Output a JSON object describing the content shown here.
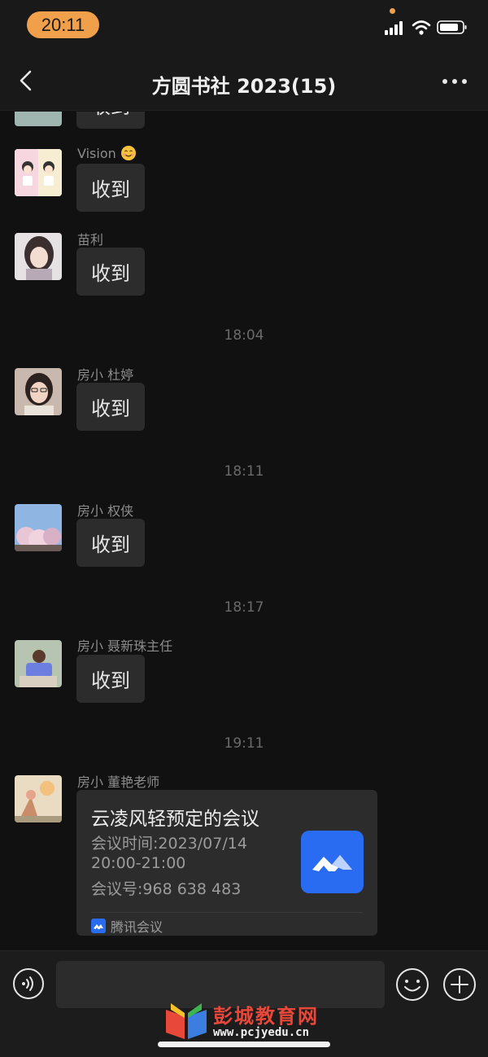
{
  "status_bar": {
    "time": "20:11"
  },
  "nav": {
    "title": "方圆书社 2023(15)"
  },
  "messages": [
    {
      "sender": "",
      "text": "收到"
    },
    {
      "sender": "Vision",
      "text": "收到"
    },
    {
      "sender": "苗利",
      "text": "收到"
    },
    {
      "sender": "房小 杜婷",
      "text": "收到"
    },
    {
      "sender": "房小 权侠",
      "text": "收到"
    },
    {
      "sender": "房小 聂新珠主任",
      "text": "收到"
    },
    {
      "sender": "房小  董艳老师"
    }
  ],
  "timestamps": [
    "18:04",
    "18:11",
    "18:17",
    "19:11"
  ],
  "meeting_card": {
    "title": "云凌风轻预定的会议",
    "time_line": "会议时间:2023/07/14",
    "time_range": "20:00-21:00",
    "meeting_id": "会议号:968 638 483",
    "app_name": "腾讯会议"
  },
  "watermark": {
    "text": "彭城教育网",
    "url": "www.pcjyedu.cn"
  },
  "colors": {
    "accent_orange": "#f0a04a",
    "tencent_blue": "#2a6cf1",
    "bubble": "#2c2c2c",
    "background": "#111111"
  }
}
